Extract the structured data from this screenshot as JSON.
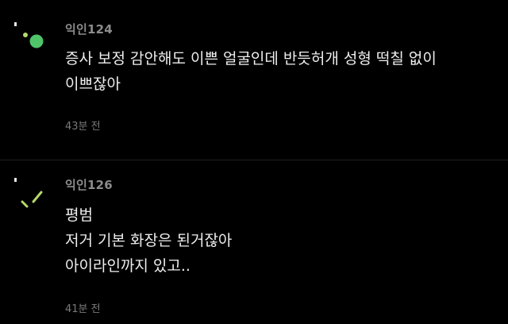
{
  "colors": {
    "background": "#000000",
    "username": "#8c8c8c",
    "body_text": "#eeeeee",
    "timestamp": "#7a7a7a",
    "avatar_1_dot": "#4fc46a",
    "avatar_2_sticks": "#b5d86c"
  },
  "comments": [
    {
      "avatar_icon": "anonymous-avatar-icon",
      "username": "익인124",
      "lines": [
        "증사 보정 감안해도 이쁜 얼굴인데 반듯허개 성형 떡칠 없이",
        "이쁘잖아"
      ],
      "timestamp": "43분 전"
    },
    {
      "avatar_icon": "anonymous-avatar-icon",
      "username": "익인126",
      "lines": [
        "평범",
        "저거 기본 화장은 된거잖아",
        "아이라인까지 있고.."
      ],
      "timestamp": "41분 전"
    }
  ]
}
